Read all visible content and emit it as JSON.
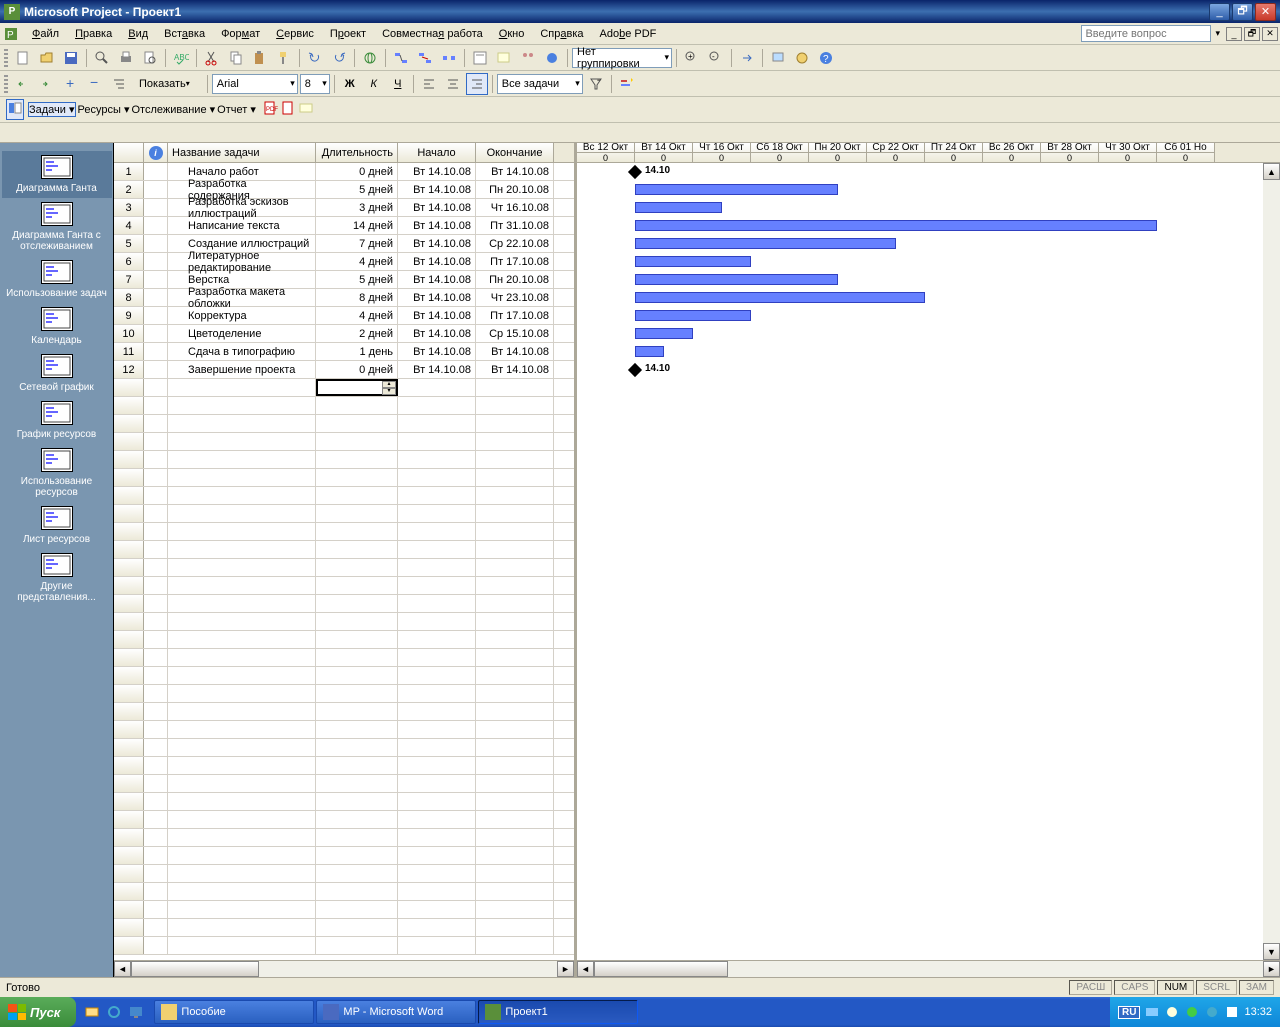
{
  "titlebar": {
    "app": "Microsoft Project",
    "doc": "Проект1"
  },
  "menu": [
    "Файл",
    "Правка",
    "Вид",
    "Вставка",
    "Формат",
    "Сервис",
    "Проект",
    "Совместная работа",
    "Окно",
    "Справка",
    "Adobe PDF"
  ],
  "help_placeholder": "Введите вопрос",
  "toolbar1": {
    "grouping": "Нет группировки"
  },
  "toolbar2": {
    "show": "Показать",
    "font": "Arial",
    "size": "8",
    "filter": "Все задачи"
  },
  "toolbar3": {
    "tasks": "Задачи",
    "resources": "Ресурсы",
    "tracking": "Отслеживание",
    "report": "Отчет"
  },
  "viewbar": [
    "Диаграмма Ганта",
    "Диаграмма Ганта с отслеживанием",
    "Использование задач",
    "Календарь",
    "Сетевой график",
    "График ресурсов",
    "Использование ресурсов",
    "Лист ресурсов",
    "Другие представления..."
  ],
  "table": {
    "headers": {
      "name": "Название задачи",
      "duration": "Длительность",
      "start": "Начало",
      "end": "Окончание"
    },
    "rows": [
      {
        "n": 1,
        "name": "Начало работ",
        "dur": "0 дней",
        "start": "Вт 14.10.08",
        "end": "Вт 14.10.08"
      },
      {
        "n": 2,
        "name": "Разработка содержания",
        "dur": "5 дней",
        "start": "Вт 14.10.08",
        "end": "Пн 20.10.08"
      },
      {
        "n": 3,
        "name": "Разработка эскизов иллюстраций",
        "dur": "3 дней",
        "start": "Вт 14.10.08",
        "end": "Чт 16.10.08"
      },
      {
        "n": 4,
        "name": "Написание текста",
        "dur": "14 дней",
        "start": "Вт 14.10.08",
        "end": "Пт 31.10.08"
      },
      {
        "n": 5,
        "name": "Создание иллюстраций",
        "dur": "7 дней",
        "start": "Вт 14.10.08",
        "end": "Ср 22.10.08"
      },
      {
        "n": 6,
        "name": "Литературное редактирование",
        "dur": "4 дней",
        "start": "Вт 14.10.08",
        "end": "Пт 17.10.08"
      },
      {
        "n": 7,
        "name": "Верстка",
        "dur": "5 дней",
        "start": "Вт 14.10.08",
        "end": "Пн 20.10.08"
      },
      {
        "n": 8,
        "name": "Разработка макета обложки",
        "dur": "8 дней",
        "start": "Вт 14.10.08",
        "end": "Чт 23.10.08"
      },
      {
        "n": 9,
        "name": "Корректура",
        "dur": "4 дней",
        "start": "Вт 14.10.08",
        "end": "Пт 17.10.08"
      },
      {
        "n": 10,
        "name": "Цветоделение",
        "dur": "2 дней",
        "start": "Вт 14.10.08",
        "end": "Ср 15.10.08"
      },
      {
        "n": 11,
        "name": "Сдача в типографию",
        "dur": "1 день",
        "start": "Вт 14.10.08",
        "end": "Вт 14.10.08"
      },
      {
        "n": 12,
        "name": "Завершение проекта",
        "dur": "0 дней",
        "start": "Вт 14.10.08",
        "end": "Вт 14.10.08"
      }
    ]
  },
  "gantt": {
    "days": [
      {
        "label": "Вс 12 Окт",
        "sub": "0"
      },
      {
        "label": "Вт 14 Окт",
        "sub": "0"
      },
      {
        "label": "Чт 16 Окт",
        "sub": "0"
      },
      {
        "label": "Сб 18 Окт",
        "sub": "0"
      },
      {
        "label": "Пн 20 Окт",
        "sub": "0"
      },
      {
        "label": "Ср 22 Окт",
        "sub": "0"
      },
      {
        "label": "Пт 24 Окт",
        "sub": "0"
      },
      {
        "label": "Вс 26 Окт",
        "sub": "0"
      },
      {
        "label": "Вт 28 Окт",
        "sub": "0"
      },
      {
        "label": "Чт 30 Окт",
        "sub": "0"
      },
      {
        "label": "Сб 01 Но",
        "sub": "0"
      }
    ],
    "milestone_label": "14.10"
  },
  "chart_data": {
    "type": "gantt",
    "x_unit": "days",
    "x_start": "2008-10-12",
    "tasks": [
      {
        "id": 1,
        "name": "Начало работ",
        "start": "2008-10-14",
        "duration_days": 0,
        "milestone": true
      },
      {
        "id": 2,
        "name": "Разработка содержания",
        "start": "2008-10-14",
        "duration_days": 5
      },
      {
        "id": 3,
        "name": "Разработка эскизов иллюстраций",
        "start": "2008-10-14",
        "duration_days": 3
      },
      {
        "id": 4,
        "name": "Написание текста",
        "start": "2008-10-14",
        "duration_days": 14
      },
      {
        "id": 5,
        "name": "Создание иллюстраций",
        "start": "2008-10-14",
        "duration_days": 7
      },
      {
        "id": 6,
        "name": "Литературное редактирование",
        "start": "2008-10-14",
        "duration_days": 4
      },
      {
        "id": 7,
        "name": "Верстка",
        "start": "2008-10-14",
        "duration_days": 5
      },
      {
        "id": 8,
        "name": "Разработка макета обложки",
        "start": "2008-10-14",
        "duration_days": 8
      },
      {
        "id": 9,
        "name": "Корректура",
        "start": "2008-10-14",
        "duration_days": 4
      },
      {
        "id": 10,
        "name": "Цветоделение",
        "start": "2008-10-14",
        "duration_days": 2
      },
      {
        "id": 11,
        "name": "Сдача в типографию",
        "start": "2008-10-14",
        "duration_days": 1
      },
      {
        "id": 12,
        "name": "Завершение проекта",
        "start": "2008-10-14",
        "duration_days": 0,
        "milestone": true
      }
    ]
  },
  "statusbar": {
    "ready": "Готово",
    "caps": "CAPS",
    "num": "NUM",
    "scrl": "SCRL",
    "ext": "РАСШ",
    "ovr": "ЗАМ"
  },
  "taskbar": {
    "start": "Пуск",
    "items": [
      {
        "label": "Пособие",
        "active": false
      },
      {
        "label": "MP - Microsoft Word",
        "active": false
      },
      {
        "label": "Проект1",
        "active": true
      }
    ],
    "lang": "RU",
    "time": "13:32"
  }
}
